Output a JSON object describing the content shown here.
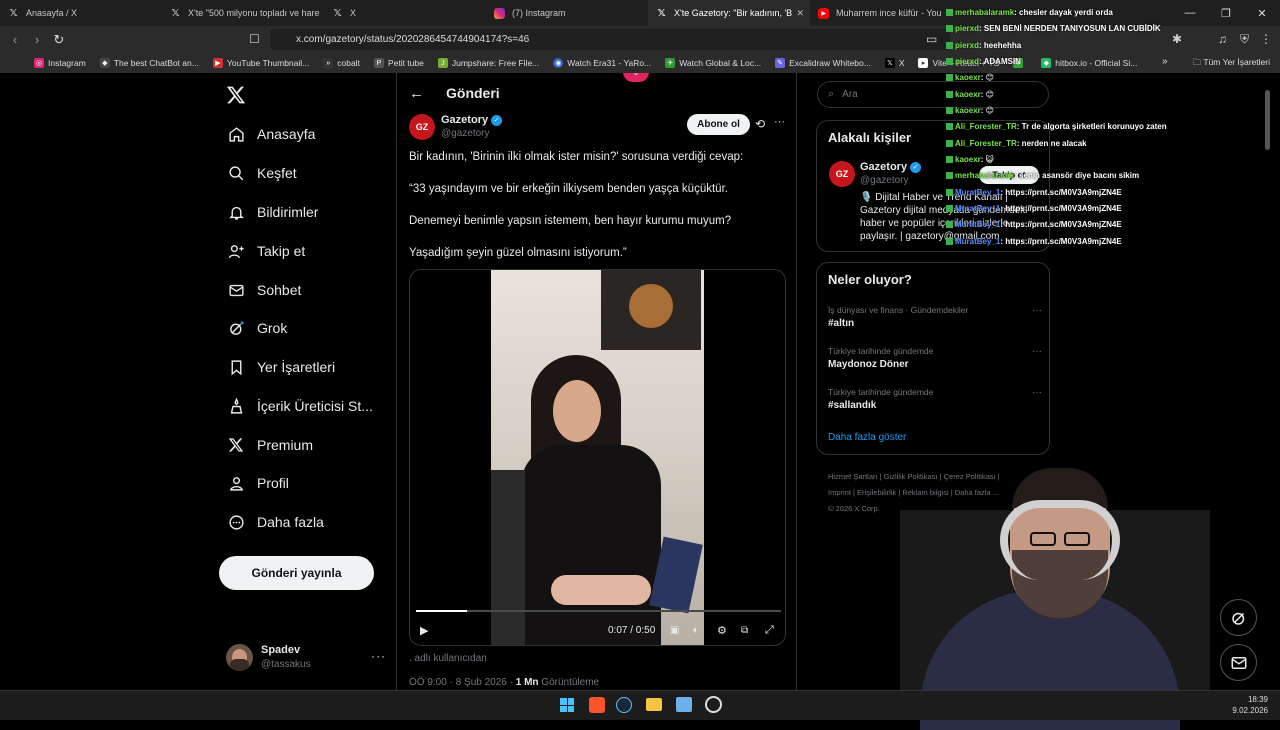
{
  "browser": {
    "tabs": [
      {
        "label": "Anasayfa / X",
        "favicon": "x-icon"
      },
      {
        "label": "X'te \"500 milyonu topladı ve hare",
        "favicon": "x-icon"
      },
      {
        "label": "X",
        "favicon": "x-icon"
      },
      {
        "label": "(7) Instagram",
        "favicon": "instagram-icon"
      },
      {
        "label": "X'te Gazetory: \"Bir kadının, 'B",
        "favicon": "x-icon",
        "active": true
      },
      {
        "label": "Muharrem ince küfür - You",
        "favicon": "youtube-icon"
      }
    ],
    "url": "x.com/gazetory/status/2020286454744904174?s=46",
    "bookmarks": [
      "Instagram",
      "The best ChatBot an...",
      "YouTube Thumbnail...",
      "cobalt",
      "Petit tube",
      "Jumpshare: Free File...",
      "Watch Era31 - YaRo...",
      "Watch Global & Loc...",
      "Excalidraw Whitebo...",
      "X",
      "Vite + React + TS",
      "",
      "hitbox.io - Official Si..."
    ],
    "all_bookmarks": "Tüm Yer İşaretleri"
  },
  "sidebar": {
    "items": [
      {
        "label": "Anasayfa",
        "icon": "home-icon"
      },
      {
        "label": "Keşfet",
        "icon": "search-icon"
      },
      {
        "label": "Bildirimler",
        "icon": "bell-icon"
      },
      {
        "label": "Takip et",
        "icon": "add-user-icon"
      },
      {
        "label": "Sohbet",
        "icon": "mail-icon"
      },
      {
        "label": "Grok",
        "icon": "grok-icon"
      },
      {
        "label": "Yer İşaretleri",
        "icon": "bookmark-icon"
      },
      {
        "label": "İçerik Üreticisi St...",
        "icon": "creator-icon"
      },
      {
        "label": "Premium",
        "icon": "x-icon"
      },
      {
        "label": "Profil",
        "icon": "profile-icon"
      },
      {
        "label": "Daha fazla",
        "icon": "more-circle-icon"
      }
    ],
    "post_button": "Gönderi yayınla",
    "user": {
      "name": "Spadev",
      "handle": "@tassakus"
    }
  },
  "post": {
    "header_title": "Gönderi",
    "author_name": "Gazetory",
    "author_handle": "@gazetory",
    "subscribe_label": "Abone ol",
    "paragraphs": [
      "Bir kadının, 'Birinin ilki olmak ister misin?' sorusuna verdiği cevap:",
      "“33 yaşındayım ve bir erkeğin ilkiysem benden yaşça küçüktür.",
      "Denemeyi benimle yapsın istemem, ben hayır kurumu muyum?",
      "Yaşadığım şeyin güzel olmasını istiyorum.”"
    ],
    "video_time": "0:07 / 0:50",
    "video_progress": 0.14,
    "caption": ". adlı kullanıcıdan",
    "timestamp": "ÖÖ 9:00 · 8 Şub 2026 · ",
    "views_count": "1 Mn",
    "views_label": " Görüntüleme"
  },
  "right": {
    "search_placeholder": "Ara",
    "related_title": "Alakalı kişiler",
    "related_name": "Gazetory",
    "related_handle": "@gazetory",
    "related_bio": "🎙️ Dijital Haber ve Trend Kanalı | Gazetory dijital medyada gündemdeki haber ve popüler içerikleri sizlerle paylaşır. | gazetory@gmail.com",
    "follow_label": "Takip et",
    "trends_title": "Neler oluyor?",
    "trends": [
      {
        "context": "İş dünyası ve finans · Gündemdekiler",
        "name": "#altın"
      },
      {
        "context": "Türkiye tarihinde gündemde",
        "name": "Maydonoz Döner"
      },
      {
        "context": "Türkiye tarihinde gündemde",
        "name": "#sallandık"
      }
    ],
    "show_more": "Daha fazla göster",
    "footer_links": [
      "Hizmet Şartları",
      "Gizlilik Politikası",
      "Çerez Politikası",
      "Imprint",
      "Erişilebilirlik",
      "Reklam bilgisi",
      "Daha fazla ..."
    ],
    "copyright": "© 2026 X Corp."
  },
  "chat": [
    {
      "user": "merhabalaramk",
      "msg": ": chesler dayak yerdi orda"
    },
    {
      "user": "pierxd",
      "msg": ": SEN BENİ NERDEN TANIYOSUN LAN CUBİDİK"
    },
    {
      "user": "pierxd",
      "msg": ": heehehha"
    },
    {
      "user": "pierxd",
      "msg": ": ADAMSIN"
    },
    {
      "user": "kaoexr",
      "msg": ": 😊"
    },
    {
      "user": "kaoexr",
      "msg": ": 😊"
    },
    {
      "user": "kaoexr",
      "msg": ": 😊"
    },
    {
      "user": "Ali_Forester_TR",
      "msg": ": Tr de algorta şirketleri korunuyo zaten"
    },
    {
      "user": "Ali_Forester_TR",
      "msg": ": nerden ne alacak"
    },
    {
      "user": "kaoexr",
      "msg": ": 😺"
    },
    {
      "user": "merhabalaramk",
      "msg": ": senin asansör diye bacını sikim"
    },
    {
      "user": "MuratBey_1",
      "msg": ": https://prnt.sc/M0V3A9mjZN4E"
    },
    {
      "user": "MuratBey_1",
      "msg": ": https://prnt.sc/M0V3A9mjZN4E"
    },
    {
      "user": "MuratBey_1",
      "msg": ": https://prnt.sc/M0V3A9mjZN4E"
    },
    {
      "user": "MuratBey_1",
      "msg": ": https://prnt.sc/M0V3A9mjZN4E"
    }
  ],
  "taskbar": {
    "time": "18:39",
    "date": "9.02.2026"
  },
  "colors": {
    "accent": "#1d9bf0",
    "chat_user": "#7be34f",
    "chat_user_alt": "#5b8cff"
  }
}
